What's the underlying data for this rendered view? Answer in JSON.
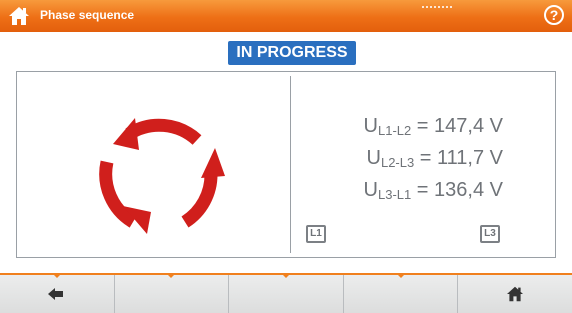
{
  "header": {
    "title": "Phase sequence",
    "help_label": "?"
  },
  "status": {
    "label": "IN PROGRESS",
    "color": "#2a6fbf"
  },
  "measurements": [
    {
      "symbol": "U",
      "subscript": "L1-L2",
      "value": " = 147,4 V"
    },
    {
      "symbol": "U",
      "subscript": "L2-L3",
      "value": " = 111,7 V"
    },
    {
      "symbol": "U",
      "subscript": "L3-L1",
      "value": " = 136,4 V"
    }
  ],
  "phase_labels": {
    "left": "L1",
    "right": "L3"
  },
  "rotation_icon": {
    "name": "rotation-arrows-icon",
    "color": "#d01f1c"
  },
  "footer": {
    "buttons": [
      "back-arrow-icon",
      "",
      "",
      "",
      "home-icon"
    ]
  },
  "colors": {
    "accent": "#ee6f16"
  }
}
